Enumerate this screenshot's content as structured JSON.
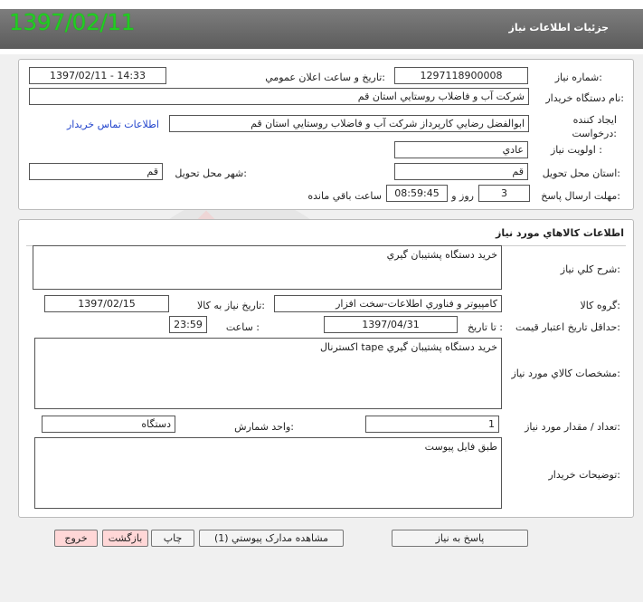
{
  "header": {
    "title": "جزئيات اطلاعات نياز",
    "date": "1397/02/11"
  },
  "info": {
    "need_number_label": "شماره نياز:",
    "need_number": "1297118900008",
    "announce_label": "تاريخ و ساعت اعلان عمومي:",
    "announce_value": "1397/02/11 - 14:33",
    "buyer_org_label": "نام دستگاه خريدار:",
    "buyer_org": "شرکت آب و فاضلاب روستايي استان قم",
    "creator_label": "ايجاد کننده درخواست:",
    "creator": "ابوالفضل رضايي کارپرداز شرکت آب و فاضلاب روستايي استان قم",
    "contact_link": "اطلاعات تماس خريدار",
    "priority_label": "اولويت نياز :",
    "priority": "عادي",
    "province_label": "استان محل تحويل:",
    "province": "قم",
    "city_label": "شهر محل تحويل:",
    "city": "قم",
    "deadline_label": "مهلت ارسال پاسخ:",
    "days": "3",
    "days_label": "روز و",
    "time_left": "08:59:45",
    "time_left_label": "ساعت باقي مانده"
  },
  "goods": {
    "section_title": "اطلاعات کالاهاي مورد نياز",
    "summary_label": "شرح کلي نياز:",
    "summary": "خريد دستگاه پشتيبان گيري",
    "group_label": "گروه کالا:",
    "group": "کامپيوتر و فناوري اطلاعات-سخت افزار",
    "need_date_label": "تاريخ نياز به کالا:",
    "need_date": "1397/02/15",
    "min_price_label": "حداقل تاريخ اعتبار قيمت:",
    "until_date_label": "تا تاريخ :",
    "until_date": "1397/04/31",
    "hour_label": "ساعت :",
    "hour": "23:59",
    "specs_label": "مشخصات کالاي مورد نياز:",
    "specs": "خريد دستگاه پشتيبان گيري  tape اکسترنال",
    "qty_label": "تعداد / مقدار مورد نياز:",
    "qty": "1",
    "unit_label": "واحد شمارش:",
    "unit": "دستگاه",
    "buyer_notes_label": "توضيحات خريدار:",
    "buyer_notes": "طبق فايل پيوست"
  },
  "buttons": {
    "reply": "پاسخ به نياز",
    "view_docs": "مشاهده مدارک پيوستي (1)",
    "print": "چاپ",
    "back": "بازگشت",
    "exit": "خروج"
  },
  "watermark": {
    "text1": "هزاره",
    "text2": "گستران",
    "text3": "ارتباط"
  },
  "colors": {
    "date_green": "#22cc22",
    "header_gray": "#6b6b6b",
    "link_blue": "#2244cc",
    "pink_button": "#ffd7d7"
  }
}
